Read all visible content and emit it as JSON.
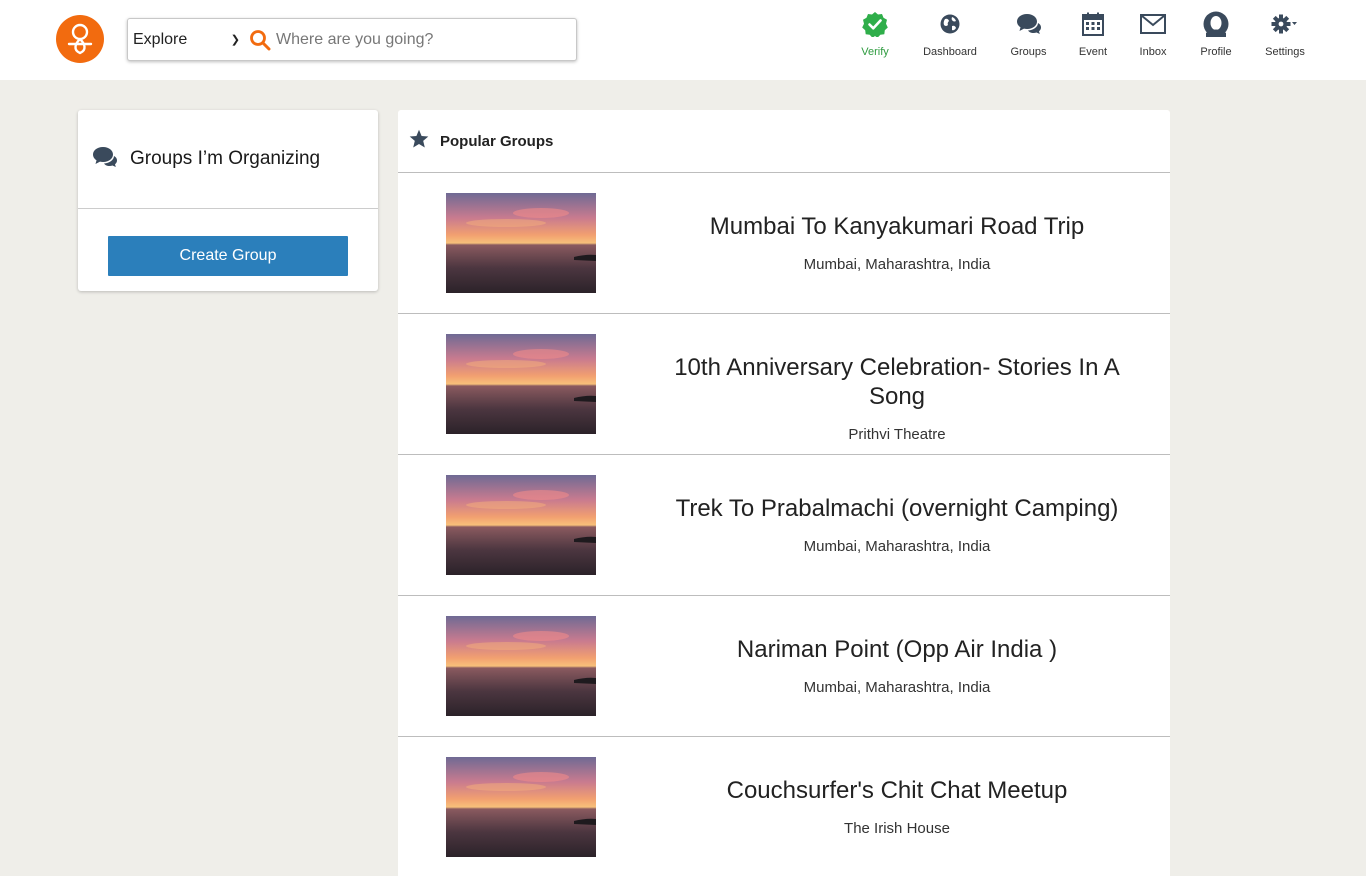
{
  "header": {
    "explore_label": "Explore",
    "search_placeholder": "Where are you going?",
    "nav": [
      {
        "label": "Verify",
        "icon": "verify-check-icon",
        "color": "#2e9b3f"
      },
      {
        "label": "Dashboard",
        "icon": "globe-icon"
      },
      {
        "label": "Groups",
        "icon": "chat-bubbles-icon"
      },
      {
        "label": "Event",
        "icon": "calendar-icon"
      },
      {
        "label": "Inbox",
        "icon": "envelope-icon"
      },
      {
        "label": "Profile",
        "icon": "user-icon"
      },
      {
        "label": "Settings",
        "icon": "gear-icon"
      }
    ]
  },
  "sidebar": {
    "title": "Groups I’m Organizing",
    "create_button": "Create Group"
  },
  "popular": {
    "title": "Popular Groups",
    "groups": [
      {
        "name": "Mumbai To Kanyakumari Road Trip",
        "location": "Mumbai, Maharashtra, India"
      },
      {
        "name": "10th Anniversary Celebration- Stories In A Song",
        "location": "Prithvi Theatre"
      },
      {
        "name": "Trek To Prabalmachi (overnight Camping)",
        "location": "Mumbai, Maharashtra, India"
      },
      {
        "name": "Nariman Point (Opp Air India )",
        "location": "Mumbai, Maharashtra, India"
      },
      {
        "name": "Couchsurfer's Chit Chat Meetup",
        "location": "The Irish House"
      }
    ]
  },
  "colors": {
    "brand": "#f26b0f",
    "button": "#2b7fbb",
    "background": "#efeee9",
    "icon": "#3a4a5c"
  }
}
